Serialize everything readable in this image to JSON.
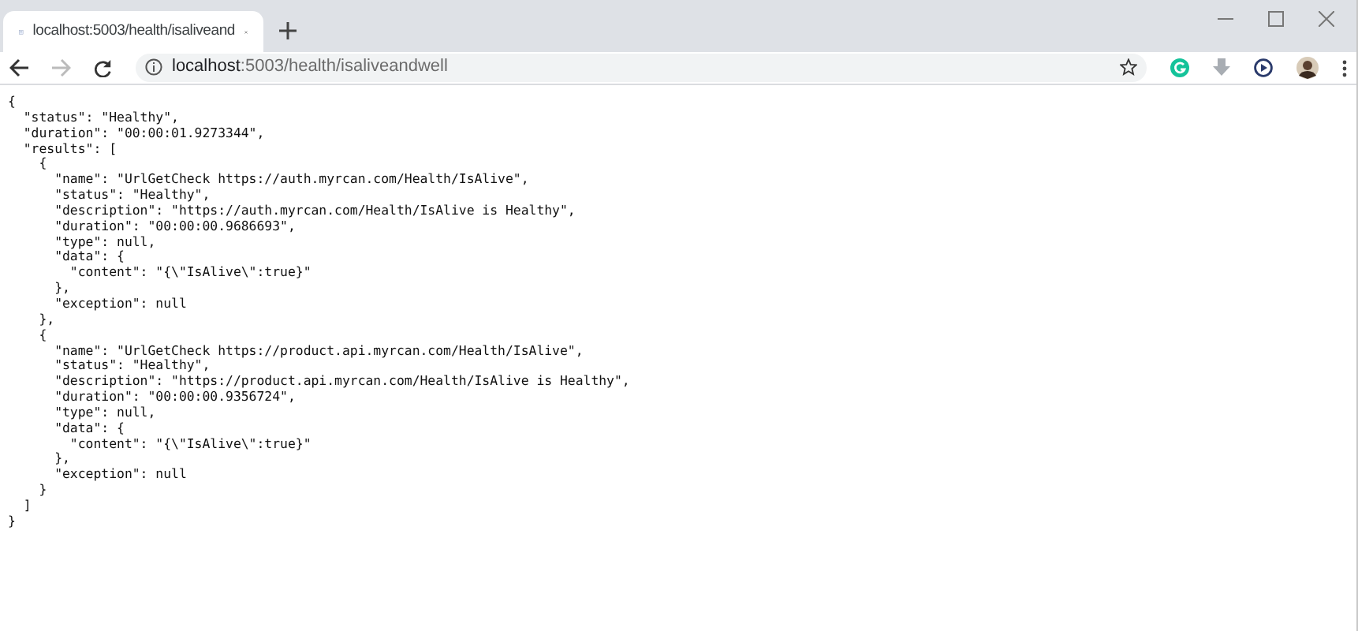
{
  "tab": {
    "title": "localhost:5003/health/isaliveand",
    "selected": true
  },
  "address_bar": {
    "url": "**localhost**:5003/health/isaliveandwell"
  },
  "body_lines": [
    "{",
    "  \"status\": \"Healthy\",",
    "  \"duration\": \"00:00:01.9273344\",",
    "  \"results\": [",
    "    {",
    "      \"name\": \"UrlGetCheck https://auth.myrcan.com/Health/IsAlive\",",
    "      \"status\": \"Healthy\",",
    "      \"description\": \"https://auth.myrcan.com/Health/IsAlive is Healthy\",",
    "      \"duration\": \"00:00:00.9686693\",",
    "      \"type\": null,",
    "      \"data\": {",
    "        \"content\": \"{\\\"IsAlive\\\":true}\"",
    "      },",
    "      \"exception\": null",
    "    },",
    "    {",
    "      \"name\": \"UrlGetCheck https://product.api.myrcan.com/Health/IsAlive\",",
    "      \"status\": \"Healthy\",",
    "      \"description\": \"https://product.api.myrcan.com/Health/IsAlive is Healthy\",",
    "      \"duration\": \"00:00:00.9356724\",",
    "      \"type\": null,",
    "      \"data\": {",
    "        \"content\": \"{\\\"IsAlive\\\":true}\"",
    "      },",
    "      \"exception\": null",
    "    }",
    "  ]",
    "}"
  ]
}
